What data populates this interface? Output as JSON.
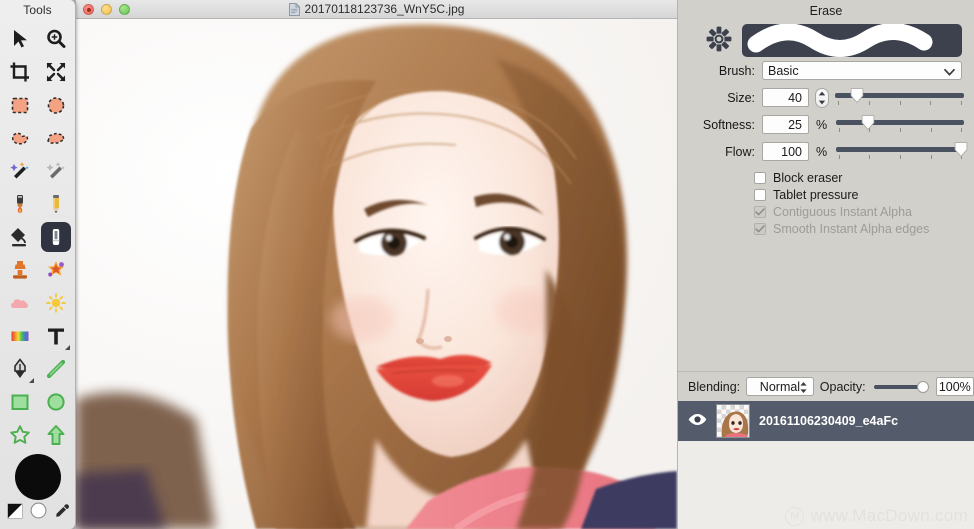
{
  "tools_palette": {
    "title": "Tools",
    "rows": [
      [
        {
          "name": "arrow-select-tool",
          "icon": "arrow-cursor-icon"
        },
        {
          "name": "zoom-tool",
          "icon": "magnifier-plus-icon"
        }
      ],
      [
        {
          "name": "crop-tool",
          "icon": "crop-icon"
        },
        {
          "name": "resize-tool",
          "icon": "arrows-expand-icon"
        }
      ],
      [
        {
          "name": "rectangular-marquee-tool",
          "icon": "rect-marquee-icon"
        },
        {
          "name": "elliptical-marquee-tool",
          "icon": "ellipse-marquee-icon"
        }
      ],
      [
        {
          "name": "lasso-tool",
          "icon": "lasso-icon"
        },
        {
          "name": "polygonal-lasso-tool",
          "icon": "polygon-lasso-icon"
        }
      ],
      [
        {
          "name": "instant-alpha-tool",
          "icon": "magic-wand-icon"
        },
        {
          "name": "smart-lasso-tool",
          "icon": "magic-wand-dim-icon"
        }
      ],
      [
        {
          "name": "brush-tool",
          "icon": "paintbrush-icon"
        },
        {
          "name": "pencil-tool",
          "icon": "pencil-icon"
        }
      ],
      [
        {
          "name": "fill-tool",
          "icon": "paint-bucket-icon"
        },
        {
          "name": "eraser-tool",
          "icon": "eraser-icon"
        }
      ],
      [
        {
          "name": "clone-stamp-tool",
          "icon": "stamp-icon"
        },
        {
          "name": "retouch-tool",
          "icon": "sparkle-retouch-icon"
        }
      ],
      [
        {
          "name": "blur-tool",
          "icon": "cloud-blur-icon"
        },
        {
          "name": "sharpen-tool",
          "icon": "sun-sharpen-icon"
        }
      ],
      [
        {
          "name": "gradient-tool",
          "icon": "gradient-icon"
        },
        {
          "name": "text-tool",
          "icon": "text-t-icon"
        }
      ],
      [
        {
          "name": "pen-tool",
          "icon": "fountain-pen-icon"
        },
        {
          "name": "line-tool",
          "icon": "line-icon"
        }
      ],
      [
        {
          "name": "rectangle-shape-tool",
          "icon": "square-shape-icon"
        },
        {
          "name": "ellipse-shape-tool",
          "icon": "circle-shape-icon"
        }
      ],
      [
        {
          "name": "star-shape-tool",
          "icon": "star-shape-icon"
        },
        {
          "name": "arrow-shape-tool",
          "icon": "arrow-shape-icon"
        }
      ]
    ],
    "selected_tool": "eraser-tool",
    "foreground_color": "#0b0b0b",
    "background_color": "#ffffff"
  },
  "image_window": {
    "title": "20170118123736_WnY5C.jpg",
    "traffic_lights": [
      "close",
      "minimize",
      "zoom"
    ],
    "traffic_colors": {
      "close": "#ec6a5e",
      "minimize": "#f4bf4f",
      "zoom": "#61c454"
    }
  },
  "inspector": {
    "header": "Erase",
    "brush": {
      "label": "Brush:",
      "value": "Basic",
      "preview_bg": "#3c414d",
      "preview_stroke": "#ffffff"
    },
    "size": {
      "label": "Size:",
      "value": "40",
      "slider_percent": 17
    },
    "softness": {
      "label": "Softness:",
      "value": "25",
      "unit": "%",
      "slider_percent": 25
    },
    "flow": {
      "label": "Flow:",
      "value": "100",
      "unit": "%",
      "slider_percent": 98
    },
    "checkboxes": [
      {
        "label": "Block eraser",
        "checked": false,
        "enabled": true
      },
      {
        "label": "Tablet pressure",
        "checked": false,
        "enabled": true
      },
      {
        "label": "Contiguous Instant Alpha",
        "checked": true,
        "enabled": false
      },
      {
        "label": "Smooth Instant Alpha edges",
        "checked": true,
        "enabled": false
      }
    ]
  },
  "layers_bar": {
    "blending_label": "Blending:",
    "blending_value": "Normal",
    "opacity_label": "Opacity:",
    "opacity_value": "100%",
    "opacity_percent": 100
  },
  "layers": [
    {
      "name": "20161106230409_e4aFc",
      "visible": true,
      "selected": true
    }
  ],
  "watermark": {
    "text": "www.MacDown.com",
    "logo_letter": "M"
  },
  "colors": {
    "panel_bg": "#d2d0cb",
    "tools_bg": "#e6e6e6",
    "selected_layer_bg": "#545b6b",
    "slider_track": "#4a5160",
    "accent_dark": "#2f3440"
  }
}
